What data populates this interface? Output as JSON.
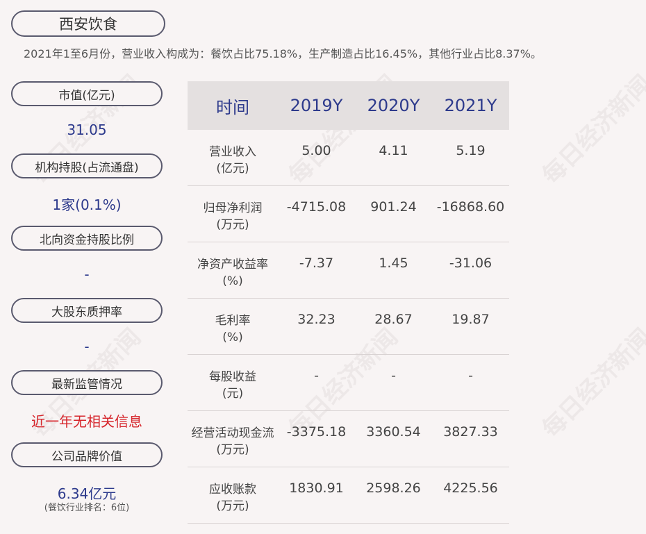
{
  "title": "西安饮食",
  "summary": "2021年1至6月份，营业收入构成为：餐饮占比75.18%，生产制造占比16.45%，其他行业占比8.37%。",
  "sidebar": [
    {
      "label": "市值(亿元)",
      "value": "31.05"
    },
    {
      "label": "机构持股(占流通盘)",
      "value": "1家(0.1%)"
    },
    {
      "label": "北向资金持股比例",
      "value": "-"
    },
    {
      "label": "大股东质押率",
      "value": "-"
    },
    {
      "label": "最新监管情况",
      "value": "近一年无相关信息"
    },
    {
      "label": "公司品牌价值",
      "value": "6.34亿元",
      "note": "(餐饮行业排名：6位)"
    }
  ],
  "table": {
    "headers": [
      "时间",
      "2019Y",
      "2020Y",
      "2021Y"
    ],
    "rows": [
      {
        "label": "营业收入",
        "unit": "(亿元)",
        "values": [
          "5.00",
          "4.11",
          "5.19"
        ]
      },
      {
        "label": "归母净利润",
        "unit": "(万元)",
        "values": [
          "-4715.08",
          "901.24",
          "-16868.60"
        ]
      },
      {
        "label": "净资产收益率",
        "unit": "(%)",
        "values": [
          "-7.37",
          "1.45",
          "-31.06"
        ]
      },
      {
        "label": "毛利率",
        "unit": "(%)",
        "values": [
          "32.23",
          "28.67",
          "19.87"
        ]
      },
      {
        "label": "每股收益",
        "unit": "(元)",
        "values": [
          "-",
          "-",
          "-"
        ]
      },
      {
        "label": "经营活动现金流",
        "unit": "(万元)",
        "values": [
          "-3375.18",
          "3360.54",
          "3827.33"
        ]
      },
      {
        "label": "应收账款",
        "unit": "(万元)",
        "values": [
          "1830.91",
          "2598.26",
          "4225.56"
        ]
      }
    ]
  },
  "watermark": "每日经济新闻",
  "colors": {
    "accent": "#2d3a8c",
    "alert": "#d6252b",
    "header_bg": "#e4e0e0"
  }
}
